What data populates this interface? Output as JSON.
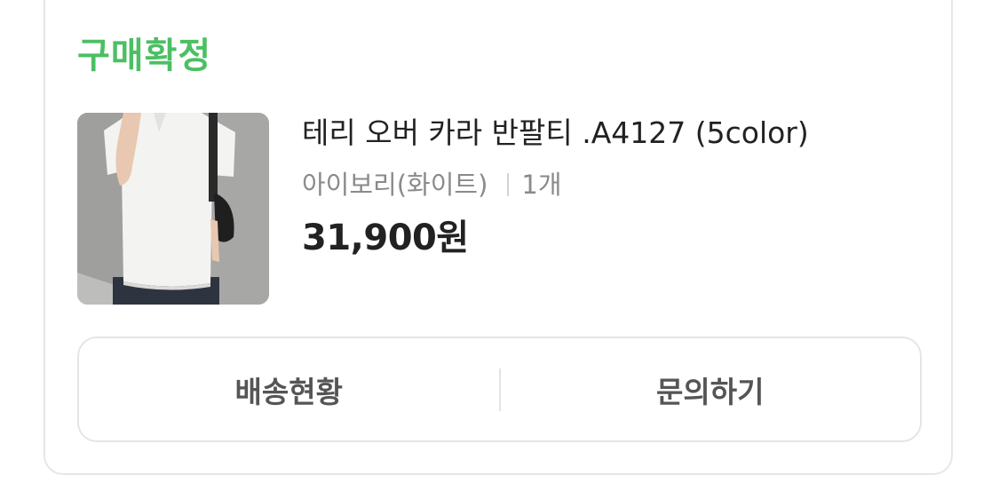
{
  "order": {
    "status": "구매확정",
    "status_color": "#4cbf63",
    "product": {
      "thumbnail_icon": "white-polo-tshirt-photo",
      "name": "테리 오버 카라 반팔티 .A4127 (5color)",
      "option": "아이보리(화이트)",
      "quantity": "1개",
      "price": "31,900원"
    },
    "actions": {
      "shipping_label": "배송현황",
      "inquiry_label": "문의하기"
    }
  }
}
